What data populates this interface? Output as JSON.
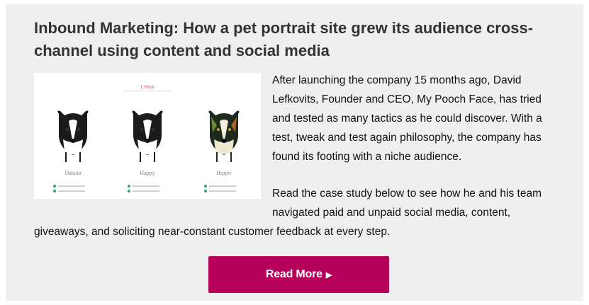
{
  "article": {
    "title": "Inbound Marketing: How a pet portrait site grew its audience cross-channel using content and social media",
    "paragraphs": [
      "After launching the company 15 months ago, David Lefkovits, Founder and CEO, My Pooch Face, has tried and tested as many tactics as he could discover. With a test, tweak and test again philosophy, the company has found its footing with a niche audience.",
      "Read the case study below to see how he and his team navigated paid and unpaid social media, content, giveaways, and soliciting near-constant customer feedback at every step."
    ],
    "button_label": "Read More",
    "button_icon": "play-triangle-icon"
  },
  "thumbnail": {
    "tag": "1 Hour",
    "pets": [
      {
        "name": "Dakota"
      },
      {
        "name": "Happy"
      },
      {
        "name": "Hippie"
      }
    ],
    "accent_color": "#2aa87a"
  },
  "colors": {
    "card_bg": "#efeff0",
    "button": "#b5005a",
    "title": "#333333"
  }
}
